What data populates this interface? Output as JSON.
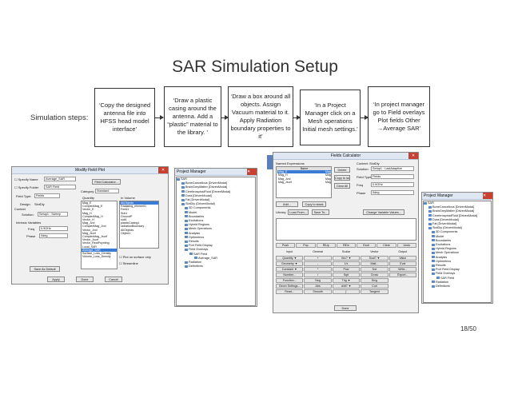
{
  "slide": {
    "title": "SAR Simulation Setup",
    "simulation_label": "Simulation steps:",
    "page_number": "18/50",
    "steps": [
      "‘Copy the designed antenna file into HFSS head model interface’",
      "‘Draw a plastic casing around the antenna. Add a “plastic” material to the library. ’",
      "‘Draw a box around all objects. Assign Vacuum material to it. Apply Radiation boundary properties to it’",
      "‘In a Project Manager click on a Mesh operations Initial mesh settings.’",
      "‘In project manager go to Field overlays Plot fields Other →Average SAR’"
    ]
  },
  "modify_field_plot": {
    "title": "Modify Field Plot",
    "specify_name": "Specify Name",
    "name_value": "Average_SAR",
    "specify_folder": "Specify Folder",
    "folder_value": "SAR Field",
    "field_type_label": "Field Type:",
    "field_type_value": "Fields",
    "design_label": "Design:",
    "design_value": "SlotDiy",
    "context_label": "Context",
    "solution_label": "Solution:",
    "solution_value": "Setup1 : Sweep",
    "intrinsic_label": "Intrinsic Variables",
    "freq_label": "Freq",
    "freq_value": "0.9GHz",
    "phase_label": "Phase",
    "phase_value": "0deg",
    "save_default": "Save As Default",
    "calc_btn": "Field Calculator...",
    "category_label": "Category:",
    "category_value": "Standard",
    "quantity_header": "Quantity",
    "invol_header": "In Volume",
    "quantities": [
      "Mag_E",
      "ComplexMag_E",
      "Vector_E",
      "Mag_H",
      "ComplexMag_H",
      "Vector_H",
      "Mag_Jvol",
      "ComplexMag_Jvol",
      "Vector_Jvol",
      "Mag_Jsurf",
      "ComplexMag_Jsurf",
      "Vector_Jsurf",
      "Vector_RealPoynting",
      "Local_SAR",
      "Average_SAR",
      "Surface_Loss_Density",
      "Volume_Loss_Density"
    ],
    "volumes": [
      "AllObjects",
      "Radiating_element1",
      "Feed1",
      "Sub1",
      "GroundP",
      "sub1",
      "plasticCasing1",
      "radiationBoundary",
      "AllObjects",
      "Object1"
    ],
    "plot_on_surface": "Plot on surface only",
    "streamline": "Streamline",
    "apply": "Apply",
    "done": "Done",
    "cancel": "Cancel"
  },
  "project_manager_left": {
    "title": "Project Manager",
    "items": [
      "SAR",
      "BoneCancellous [DrivenModal]",
      "BrainGreyMatter [DrivenModal]",
      "CerebrospinalFluid [DrivenModal]",
      "Dura [DrivenModal]",
      "Fat [DrivenModal]",
      "SlotDiy (DrivenModal)",
      "3D Components",
      "Model",
      "Boundaries",
      "Excitations",
      "Hybrid Regions",
      "Mesh Operations",
      "Analysis",
      "Optimetrics",
      "Results",
      "Port Field Display",
      "Field Overlays",
      "SAR Field",
      "Average_SAR",
      "Radiation",
      "Definitions"
    ]
  },
  "fields_calculator": {
    "title": "Fields Calculator",
    "named_expressions": "Named Expressions",
    "name_header": "Name",
    "expressions": [
      [
        "Mag_E",
        "Mag"
      ],
      [
        "Mag_H",
        "Mag"
      ],
      [
        "Mag_Jvol",
        "Mag"
      ],
      [
        "Mag_Jsurf",
        "Mag"
      ]
    ],
    "side_btns": [
      "Delete",
      "Copy to stack",
      "Clear All"
    ],
    "add": "Add...",
    "copy_to_stack": "Copy to stack",
    "library": "Library:",
    "load_from": "Load From...",
    "save_to": "Save To...",
    "context_label": "Context: SlotDiy",
    "solution_label": "Solution:",
    "solution_value": "Setup1 : LastAdaptive",
    "field_type_label": "Field Type:",
    "field_type_value": "Fields",
    "freq_label": "Freq",
    "freq_value": "0.9GHz",
    "phase_label": "Phase",
    "phase_value": "0deg",
    "change_vars": "Change Variable Values...",
    "stack_btns": [
      "Push",
      "Pop",
      "RlUp",
      "RlDn",
      "Exch",
      "Clear",
      "Undo"
    ],
    "col_headers": [
      "Input",
      "General",
      "Scalar",
      "Vector",
      "Output"
    ],
    "calc_rows": [
      [
        "Quantity ▼",
        "+",
        "Vec? ▼",
        "Scal? ▼",
        "Value"
      ],
      [
        "Geometry ▼",
        "-",
        "1/x",
        "Matl...",
        "Eval"
      ],
      [
        "Constant ▼",
        "*",
        "Pow",
        "Dot",
        "Write..."
      ],
      [
        "Number...",
        "/",
        "Sqrt",
        "Cross",
        "Export..."
      ],
      [
        "Function...",
        "Neg",
        "Trig ▼",
        "Divg",
        ""
      ],
      [
        "Geom Settings...",
        "Abs",
        "d/dt? ▼",
        "Curl",
        ""
      ],
      [
        "Read...",
        "Smooth",
        "∫",
        "Tangent",
        ""
      ]
    ],
    "done": "Done"
  },
  "project_manager_right": {
    "title": "Project Manager",
    "items": [
      "SAR",
      "BoneCancellous [DrivenModal]",
      "BrainGreyMatter [DrivenModal]",
      "CerebrospinalFluid [DrivenModal]",
      "Dura [DrivenModal]",
      "Fat [DrivenModal]",
      "SlotDiy (DrivenModal)",
      "3D Components",
      "Model",
      "Boundaries",
      "Excitations",
      "Hybrid Regions",
      "Mesh Operations",
      "Analysis",
      "Optimetrics",
      "Results",
      "Port Field Display",
      "Field Overlays",
      "SAR Field",
      "Radiation",
      "Definitions"
    ]
  }
}
